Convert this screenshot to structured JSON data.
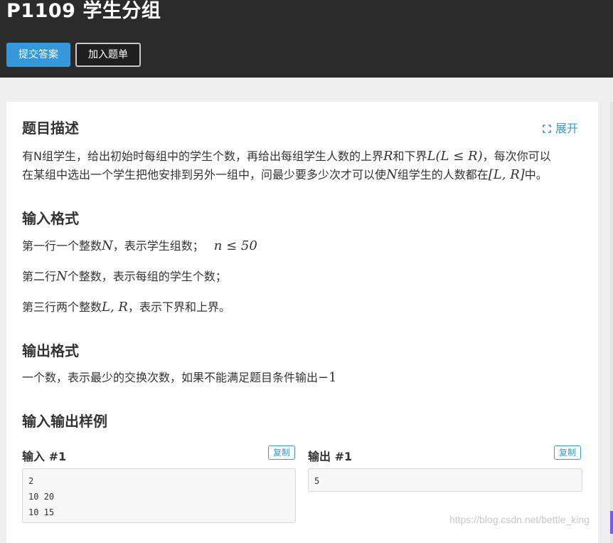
{
  "header": {
    "title": "P1109 学生分组",
    "submit_label": "提交答案",
    "add_label": "加入题单"
  },
  "description": {
    "heading": "题目描述",
    "expand_label": "展开",
    "line1_a": "有N组学生，给出初始时每组中的学生个数，再给出每组学生人数的上界",
    "line1_R": "R",
    "line1_b": "和下界",
    "line1_math": "L(L ≤ R)",
    "line1_c": "，每次你可以",
    "line2_a": "在某组中选出一个学生把他安排到另外一组中，问最少要多少次才可以使",
    "line2_N": "N",
    "line2_b": "组学生的人数都在",
    "line2_math": "[L, R]",
    "line2_c": "中。"
  },
  "input_format": {
    "heading": "输入格式",
    "l1_a": "第一行一个整数",
    "l1_N": "N",
    "l1_b": "，表示学生组数；",
    "l1_math": "n ≤ 50",
    "l2_a": "第二行",
    "l2_N": "N",
    "l2_b": "个整数，表示每组的学生个数；",
    "l3_a": "第三行两个整数",
    "l3_math": "L, R",
    "l3_b": "，表示下界和上界。"
  },
  "output_format": {
    "heading": "输出格式",
    "text": "一个数，表示最少的交换次数，如果不能满足题目条件输出",
    "math": "−1"
  },
  "samples": {
    "heading": "输入输出样例",
    "input_label": "输入 #1",
    "output_label": "输出 #1",
    "copy_label": "复制",
    "input_lines": [
      "2",
      "10 20",
      "10 15"
    ],
    "output_lines": [
      "5"
    ]
  },
  "watermark": "https://blog.csdn.net/bettle_king",
  "colors": {
    "header_bg": "#2b2b2b",
    "accent": "#3498db",
    "page_bg": "#efefef"
  }
}
